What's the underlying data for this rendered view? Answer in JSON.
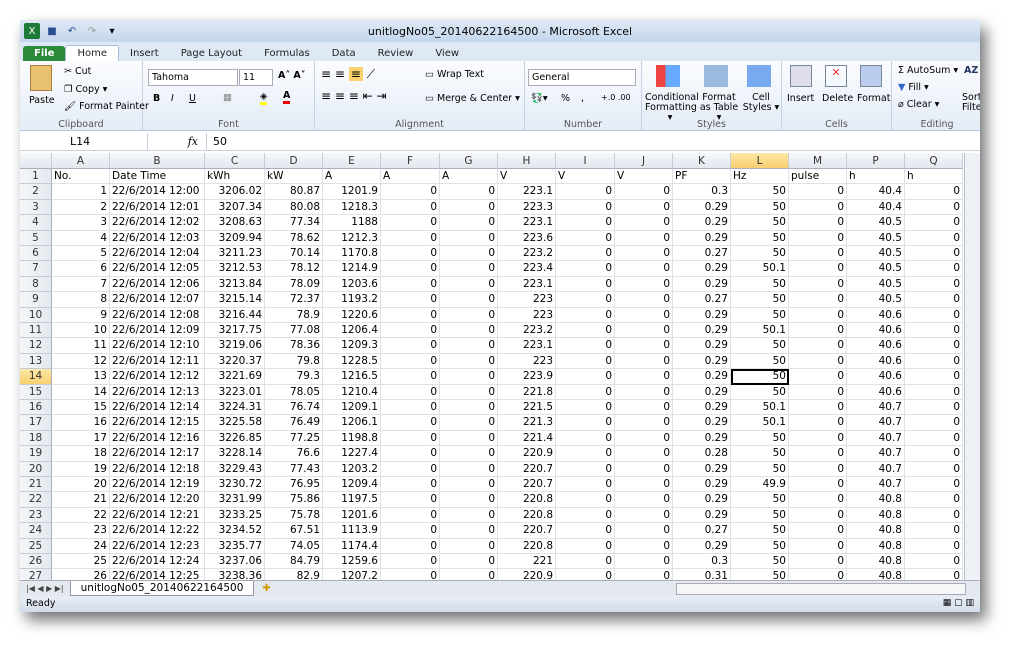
{
  "window": {
    "title": "unitlogNo05_20140622164500  -  Microsoft Excel"
  },
  "ribbon_tabs": [
    "File",
    "Home",
    "Insert",
    "Page Layout",
    "Formulas",
    "Data",
    "Review",
    "View"
  ],
  "clipboard": {
    "paste": "Paste",
    "cut": "Cut",
    "copy": "Copy ▾",
    "format_painter": "Format Painter",
    "label": "Clipboard"
  },
  "font": {
    "name": "Tahoma",
    "size": "11",
    "bold": "B",
    "italic": "I",
    "underline": "U",
    "label": "Font"
  },
  "alignment": {
    "wrap": "Wrap Text",
    "merge": "Merge & Center ▾",
    "label": "Alignment"
  },
  "number": {
    "format": "General",
    "percent": "%",
    "comma": ",",
    "label": "Number"
  },
  "styles": {
    "conditional": "Conditional Formatting ▾",
    "table": "Format as Table ▾",
    "cell": "Cell Styles ▾",
    "label": "Styles"
  },
  "cells": {
    "insert": "Insert",
    "delete": "Delete",
    "format": "Format",
    "label": "Cells"
  },
  "editing": {
    "autosum": "AutoSum ▾",
    "fill": "Fill ▾",
    "clear": "Clear ▾",
    "sort": "Sort & Filter",
    "label": "Editing"
  },
  "formula_bar": {
    "name_box": "L14",
    "fx": "fx",
    "value": "50"
  },
  "grid": {
    "columns": [
      "A",
      "B",
      "C",
      "D",
      "E",
      "F",
      "G",
      "H",
      "I",
      "J",
      "K",
      "L",
      "M",
      "P",
      "Q"
    ],
    "selected_column": "L",
    "selected_row": "14",
    "headers": [
      "No.",
      "Date Time",
      "kWh",
      "kW",
      "A",
      "A",
      "A",
      "V",
      "V",
      "V",
      "PF",
      "Hz",
      "pulse",
      "h",
      "h"
    ],
    "rows": [
      [
        "1",
        "22/6/2014 12:00",
        "3206.02",
        "80.87",
        "1201.9",
        "0",
        "0",
        "223.1",
        "0",
        "0",
        "0.3",
        "50",
        "0",
        "40.4",
        "0"
      ],
      [
        "2",
        "22/6/2014 12:01",
        "3207.34",
        "80.08",
        "1218.3",
        "0",
        "0",
        "223.3",
        "0",
        "0",
        "0.29",
        "50",
        "0",
        "40.4",
        "0"
      ],
      [
        "3",
        "22/6/2014 12:02",
        "3208.63",
        "77.34",
        "1188",
        "0",
        "0",
        "223.1",
        "0",
        "0",
        "0.29",
        "50",
        "0",
        "40.5",
        "0"
      ],
      [
        "4",
        "22/6/2014 12:03",
        "3209.94",
        "78.62",
        "1212.3",
        "0",
        "0",
        "223.6",
        "0",
        "0",
        "0.29",
        "50",
        "0",
        "40.5",
        "0"
      ],
      [
        "5",
        "22/6/2014 12:04",
        "3211.23",
        "70.14",
        "1170.8",
        "0",
        "0",
        "223.2",
        "0",
        "0",
        "0.27",
        "50",
        "0",
        "40.5",
        "0"
      ],
      [
        "6",
        "22/6/2014 12:05",
        "3212.53",
        "78.12",
        "1214.9",
        "0",
        "0",
        "223.4",
        "0",
        "0",
        "0.29",
        "50.1",
        "0",
        "40.5",
        "0"
      ],
      [
        "7",
        "22/6/2014 12:06",
        "3213.84",
        "78.09",
        "1203.6",
        "0",
        "0",
        "223.1",
        "0",
        "0",
        "0.29",
        "50",
        "0",
        "40.5",
        "0"
      ],
      [
        "8",
        "22/6/2014 12:07",
        "3215.14",
        "72.37",
        "1193.2",
        "0",
        "0",
        "223",
        "0",
        "0",
        "0.27",
        "50",
        "0",
        "40.5",
        "0"
      ],
      [
        "9",
        "22/6/2014 12:08",
        "3216.44",
        "78.9",
        "1220.6",
        "0",
        "0",
        "223",
        "0",
        "0",
        "0.29",
        "50",
        "0",
        "40.6",
        "0"
      ],
      [
        "10",
        "22/6/2014 12:09",
        "3217.75",
        "77.08",
        "1206.4",
        "0",
        "0",
        "223.2",
        "0",
        "0",
        "0.29",
        "50.1",
        "0",
        "40.6",
        "0"
      ],
      [
        "11",
        "22/6/2014 12:10",
        "3219.06",
        "78.36",
        "1209.3",
        "0",
        "0",
        "223.1",
        "0",
        "0",
        "0.29",
        "50",
        "0",
        "40.6",
        "0"
      ],
      [
        "12",
        "22/6/2014 12:11",
        "3220.37",
        "79.8",
        "1228.5",
        "0",
        "0",
        "223",
        "0",
        "0",
        "0.29",
        "50",
        "0",
        "40.6",
        "0"
      ],
      [
        "13",
        "22/6/2014 12:12",
        "3221.69",
        "79.3",
        "1216.5",
        "0",
        "0",
        "223.9",
        "0",
        "0",
        "0.29",
        "50",
        "0",
        "40.6",
        "0"
      ],
      [
        "14",
        "22/6/2014 12:13",
        "3223.01",
        "78.05",
        "1210.4",
        "0",
        "0",
        "221.8",
        "0",
        "0",
        "0.29",
        "50",
        "0",
        "40.6",
        "0"
      ],
      [
        "15",
        "22/6/2014 12:14",
        "3224.31",
        "76.74",
        "1209.1",
        "0",
        "0",
        "221.5",
        "0",
        "0",
        "0.29",
        "50.1",
        "0",
        "40.7",
        "0"
      ],
      [
        "16",
        "22/6/2014 12:15",
        "3225.58",
        "76.49",
        "1206.1",
        "0",
        "0",
        "221.3",
        "0",
        "0",
        "0.29",
        "50.1",
        "0",
        "40.7",
        "0"
      ],
      [
        "17",
        "22/6/2014 12:16",
        "3226.85",
        "77.25",
        "1198.8",
        "0",
        "0",
        "221.4",
        "0",
        "0",
        "0.29",
        "50",
        "0",
        "40.7",
        "0"
      ],
      [
        "18",
        "22/6/2014 12:17",
        "3228.14",
        "76.6",
        "1227.4",
        "0",
        "0",
        "220.9",
        "0",
        "0",
        "0.28",
        "50",
        "0",
        "40.7",
        "0"
      ],
      [
        "19",
        "22/6/2014 12:18",
        "3229.43",
        "77.43",
        "1203.2",
        "0",
        "0",
        "220.7",
        "0",
        "0",
        "0.29",
        "50",
        "0",
        "40.7",
        "0"
      ],
      [
        "20",
        "22/6/2014 12:19",
        "3230.72",
        "76.95",
        "1209.4",
        "0",
        "0",
        "220.7",
        "0",
        "0",
        "0.29",
        "49.9",
        "0",
        "40.7",
        "0"
      ],
      [
        "21",
        "22/6/2014 12:20",
        "3231.99",
        "75.86",
        "1197.5",
        "0",
        "0",
        "220.8",
        "0",
        "0",
        "0.29",
        "50",
        "0",
        "40.8",
        "0"
      ],
      [
        "22",
        "22/6/2014 12:21",
        "3233.25",
        "75.78",
        "1201.6",
        "0",
        "0",
        "220.8",
        "0",
        "0",
        "0.29",
        "50",
        "0",
        "40.8",
        "0"
      ],
      [
        "23",
        "22/6/2014 12:22",
        "3234.52",
        "67.51",
        "1113.9",
        "0",
        "0",
        "220.7",
        "0",
        "0",
        "0.27",
        "50",
        "0",
        "40.8",
        "0"
      ],
      [
        "24",
        "22/6/2014 12:23",
        "3235.77",
        "74.05",
        "1174.4",
        "0",
        "0",
        "220.8",
        "0",
        "0",
        "0.29",
        "50",
        "0",
        "40.8",
        "0"
      ],
      [
        "25",
        "22/6/2014 12:24",
        "3237.06",
        "84.79",
        "1259.6",
        "0",
        "0",
        "221",
        "0",
        "0",
        "0.3",
        "50",
        "0",
        "40.8",
        "0"
      ],
      [
        "26",
        "22/6/2014 12:25",
        "3238.36",
        "82.9",
        "1207.2",
        "0",
        "0",
        "220.9",
        "0",
        "0",
        "0.31",
        "50",
        "0",
        "40.8",
        "0"
      ]
    ]
  },
  "sheet_tab": "unitlogNo05_20140622164500",
  "status": "Ready"
}
